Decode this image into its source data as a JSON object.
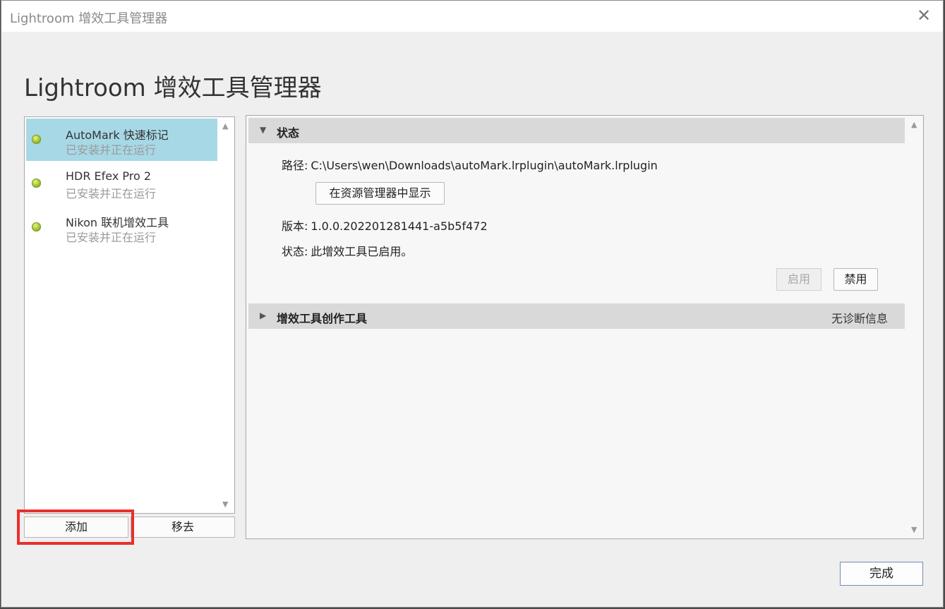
{
  "window": {
    "title": "Lightroom 增效工具管理器",
    "close_label": "✕"
  },
  "heading": "Lightroom 增效工具管理器",
  "plugins": [
    {
      "name": "AutoMark 快速标记",
      "status": "已安装并正在运行",
      "selected": true
    },
    {
      "name": "HDR Efex Pro 2",
      "status": "已安装并正在运行",
      "selected": false
    },
    {
      "name": "Nikon 联机增效工具",
      "status": "已安装并正在运行",
      "selected": false
    }
  ],
  "list_buttons": {
    "add": "添加",
    "remove": "移去"
  },
  "status_section": {
    "toggle": "▼",
    "title": "状态",
    "path_key": "路径:",
    "path_value": "C:\\Users\\wen\\Downloads\\autoMark.lrplugin\\autoMark.lrplugin",
    "show_in_explorer": "在资源管理器中显示",
    "version_key": "版本:",
    "version_value": "1.0.0.202201281441-a5b5f472",
    "state_key": "状态:",
    "state_value": "此增效工具已启用。",
    "enable_label": "启用",
    "disable_label": "禁用"
  },
  "authoring_section": {
    "toggle": "▶",
    "title": "增效工具创作工具",
    "right_label": "无诊断信息"
  },
  "scroll": {
    "up": "▲",
    "down": "▼"
  },
  "done_label": "完成"
}
